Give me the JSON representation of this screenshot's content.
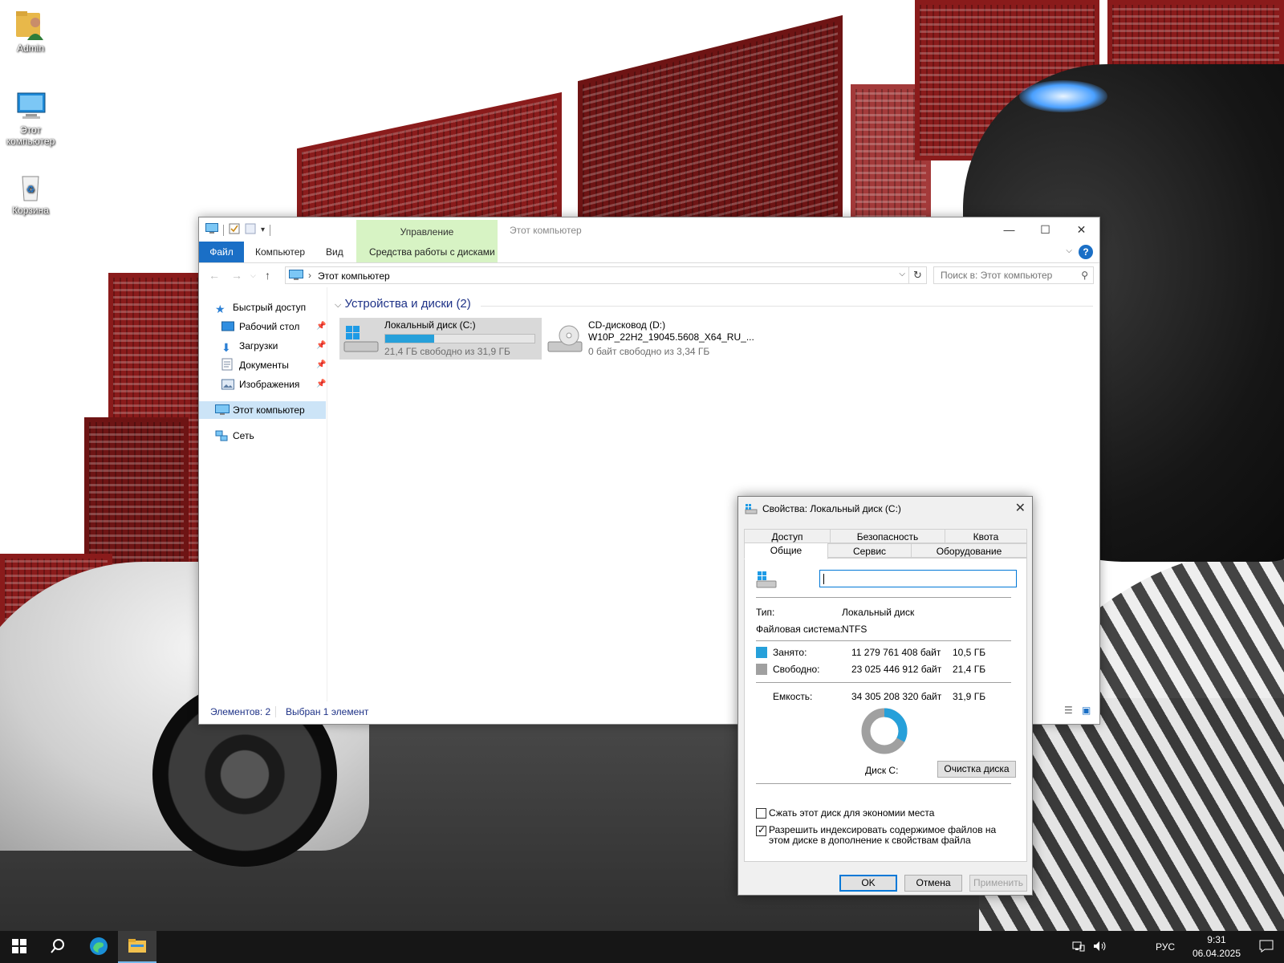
{
  "desktop": {
    "icons": [
      {
        "label": "Admin"
      },
      {
        "label": "Этот компьютер"
      },
      {
        "label": "Корзина"
      }
    ]
  },
  "explorer": {
    "title": "Этот компьютер",
    "context_tab_group": "Управление",
    "ribbon_tabs": [
      "Файл",
      "Компьютер",
      "Вид",
      "Средства работы с дисками"
    ],
    "address": {
      "crumb": "Этот компьютер"
    },
    "search": {
      "placeholder": "Поиск в: Этот компьютер"
    },
    "nav": {
      "quick_access": "Быстрый доступ",
      "items": [
        "Рабочий стол",
        "Загрузки",
        "Документы",
        "Изображения"
      ],
      "this_pc": "Этот компьютер",
      "network": "Сеть"
    },
    "group_header": "Устройства и диски (2)",
    "drives": [
      {
        "name": "Локальный диск (C:)",
        "free_text": "21,4 ГБ свободно из 31,9 ГБ",
        "used_fraction": 0.33
      },
      {
        "name": "CD-дисковод (D:)",
        "label": "W10P_22H2_19045.5608_X64_RU_...",
        "free_text": "0 байт свободно из 3,34 ГБ"
      }
    ],
    "status": {
      "count": "Элементов: 2",
      "selected": "Выбран 1 элемент"
    }
  },
  "properties": {
    "title": "Свойства: Локальный диск (C:)",
    "tabs_row1": [
      "Доступ",
      "Безопасность",
      "Квота"
    ],
    "tabs_row2": [
      "Общие",
      "Сервис",
      "Оборудование"
    ],
    "type_label": "Тип:",
    "type_value": "Локальный диск",
    "fs_label": "Файловая система:",
    "fs_value": "NTFS",
    "used_label": "Занято:",
    "used_bytes": "11 279 761 408 байт",
    "used_gb": "10,5 ГБ",
    "free_label": "Свободно:",
    "free_bytes": "23 025 446 912 байт",
    "free_gb": "21,4 ГБ",
    "capacity_label": "Емкость:",
    "capacity_bytes": "34 305 208 320 байт",
    "capacity_gb": "31,9 ГБ",
    "disk_label": "Диск C:",
    "cleanup_button": "Очистка диска",
    "compress_label": "Сжать этот диск для экономии места",
    "index_label": "Разрешить индексировать содержимое файлов на этом диске в дополнение к свойствам файла",
    "compress_checked": false,
    "index_checked": true,
    "ok": "OK",
    "cancel": "Отмена",
    "apply": "Применить",
    "used_fraction": 0.329,
    "colors": {
      "used": "#26a0da",
      "free": "#a0a0a0"
    }
  },
  "taskbar": {
    "lang": "РУС",
    "time": "9:31",
    "date": "06.04.2025"
  }
}
